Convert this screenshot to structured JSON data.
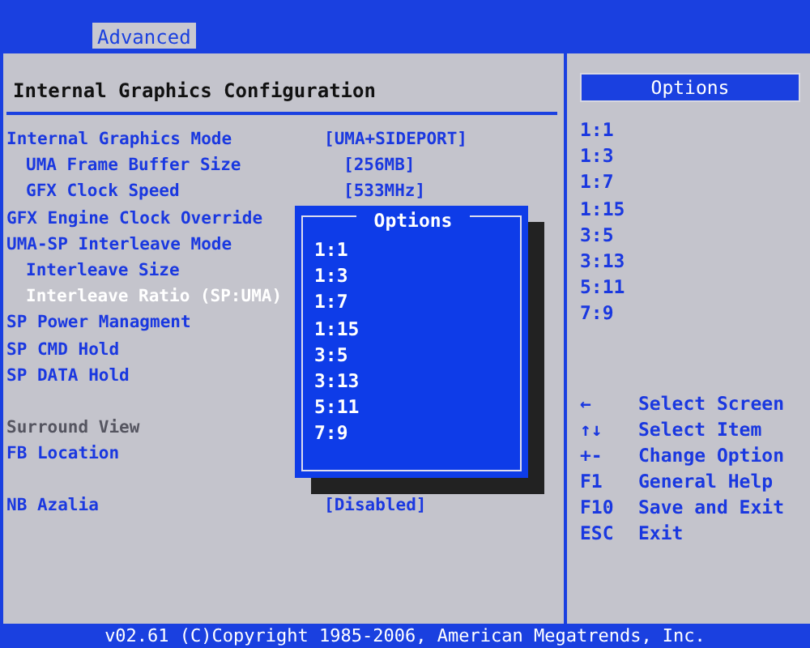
{
  "menu_bar": {
    "tabs": [
      {
        "label": "Advanced",
        "selected": true
      }
    ]
  },
  "section_title": "Internal Graphics Configuration",
  "settings": {
    "groups": [
      [
        {
          "label": "Internal Graphics Mode",
          "value": "[UMA+SIDEPORT]",
          "selected": false,
          "disabled": false,
          "children": [
            {
              "label": "UMA Frame Buffer Size",
              "value": "[256MB]",
              "selected": false,
              "disabled": false
            },
            {
              "label": "GFX Clock Speed",
              "value": "[533MHz]",
              "selected": false,
              "disabled": false
            }
          ]
        },
        {
          "label": "GFX Engine Clock Override",
          "selected": false,
          "disabled": false
        },
        {
          "label": "UMA-SP Interleave Mode",
          "selected": false,
          "disabled": false,
          "children": [
            {
              "label": "Interleave Size",
              "selected": false,
              "disabled": false
            },
            {
              "label": "Interleave Ratio (SP:UMA)",
              "selected": true,
              "disabled": false
            }
          ]
        },
        {
          "label": "SP Power Managment",
          "selected": false,
          "disabled": false
        },
        {
          "label": "SP CMD Hold",
          "selected": false,
          "disabled": false
        },
        {
          "label": "SP DATA Hold",
          "selected": false,
          "disabled": false
        }
      ],
      [
        {
          "label": "Surround View",
          "selected": false,
          "disabled": true
        },
        {
          "label": "FB Location",
          "selected": false,
          "disabled": false
        }
      ],
      [
        {
          "label": "NB Azalia",
          "value": "[Disabled]",
          "selected": false,
          "disabled": false
        }
      ]
    ]
  },
  "popup": {
    "title": "Options",
    "options": [
      "1:1",
      "1:3",
      "1:7",
      "1:15",
      "3:5",
      "3:13",
      "5:11",
      "7:9"
    ]
  },
  "help_panel": {
    "title": "Options",
    "options": [
      "1:1",
      "1:3",
      "1:7",
      "1:15",
      "3:5",
      "3:13",
      "5:11",
      "7:9"
    ],
    "keys": [
      {
        "key": "←",
        "action": "Select Screen"
      },
      {
        "key": "↑↓",
        "action": "Select Item"
      },
      {
        "key": "+-",
        "action": "Change Option"
      },
      {
        "key": "F1",
        "action": "General Help"
      },
      {
        "key": "F10",
        "action": "Save and Exit"
      },
      {
        "key": "ESC",
        "action": "Exit"
      }
    ]
  },
  "footer": "v02.61 (C)Copyright 1985-2006, American Megatrends, Inc."
}
